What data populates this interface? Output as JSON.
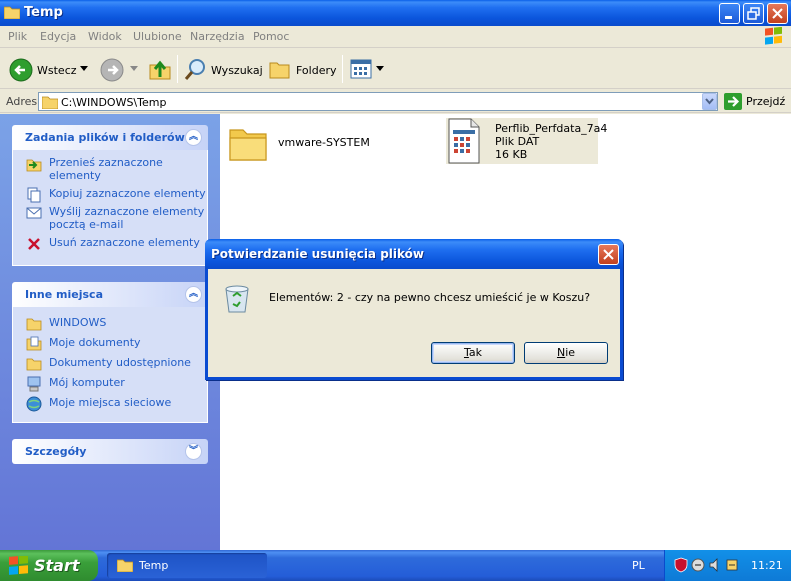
{
  "window": {
    "title": "Temp"
  },
  "menu": [
    "Plik",
    "Edycja",
    "Widok",
    "Ulubione",
    "Narzędzia",
    "Pomoc"
  ],
  "toolbar": {
    "back_label": "Wstecz",
    "search_label": "Wyszukaj",
    "folders_label": "Foldery"
  },
  "address": {
    "label": "Adres",
    "value": "C:\\WINDOWS\\Temp",
    "go_label": "Przejdź"
  },
  "panels": {
    "tasks": {
      "title": "Zadania plików i folderów",
      "items": [
        {
          "label_line1": "Przenieś zaznaczone",
          "label_line2": "elementy",
          "icon": "move-icon"
        },
        {
          "label_line1": "Kopiuj zaznaczone elementy",
          "label_line2": "",
          "icon": "copy-icon"
        },
        {
          "label_line1": "Wyślij zaznaczone elementy",
          "label_line2": "pocztą e-mail",
          "icon": "email-icon"
        },
        {
          "label_line1": "Usuń zaznaczone elementy",
          "label_line2": "",
          "icon": "delete-icon"
        }
      ]
    },
    "places": {
      "title": "Inne miejsca",
      "items": [
        {
          "label": "WINDOWS",
          "icon": "folder-icon"
        },
        {
          "label": "Moje dokumenty",
          "icon": "my-documents-icon"
        },
        {
          "label": "Dokumenty udostępnione",
          "icon": "folder-icon"
        },
        {
          "label": "Mój komputer",
          "icon": "computer-icon"
        },
        {
          "label": "Moje miejsca sieciowe",
          "icon": "network-icon"
        }
      ]
    },
    "details": {
      "title": "Szczegóły"
    }
  },
  "files": [
    {
      "name": "vmware-SYSTEM",
      "type": "folder"
    },
    {
      "name": "Perflib_Perfdata_7a4",
      "type_label": "Plik DAT",
      "size": "16 KB"
    }
  ],
  "dialog": {
    "title": "Potwierdzanie usunięcia plików",
    "message": "Elementów: 2 - czy na pewno chcesz umieścić je w Koszu?",
    "yes_label": "Tak",
    "yes_rest": "ak",
    "yes_accel": "T",
    "no_label": "Nie",
    "no_accel": "N",
    "no_rest": "ie"
  },
  "taskbar": {
    "start_label": "Start",
    "task_label": "Temp",
    "language": "PL",
    "clock": "11:21"
  },
  "colors": {
    "title_blue": "#0b55dc",
    "panel_link": "#215dc6",
    "start_green": "#3a9f3a",
    "tray_blue": "#0e7ad6"
  }
}
